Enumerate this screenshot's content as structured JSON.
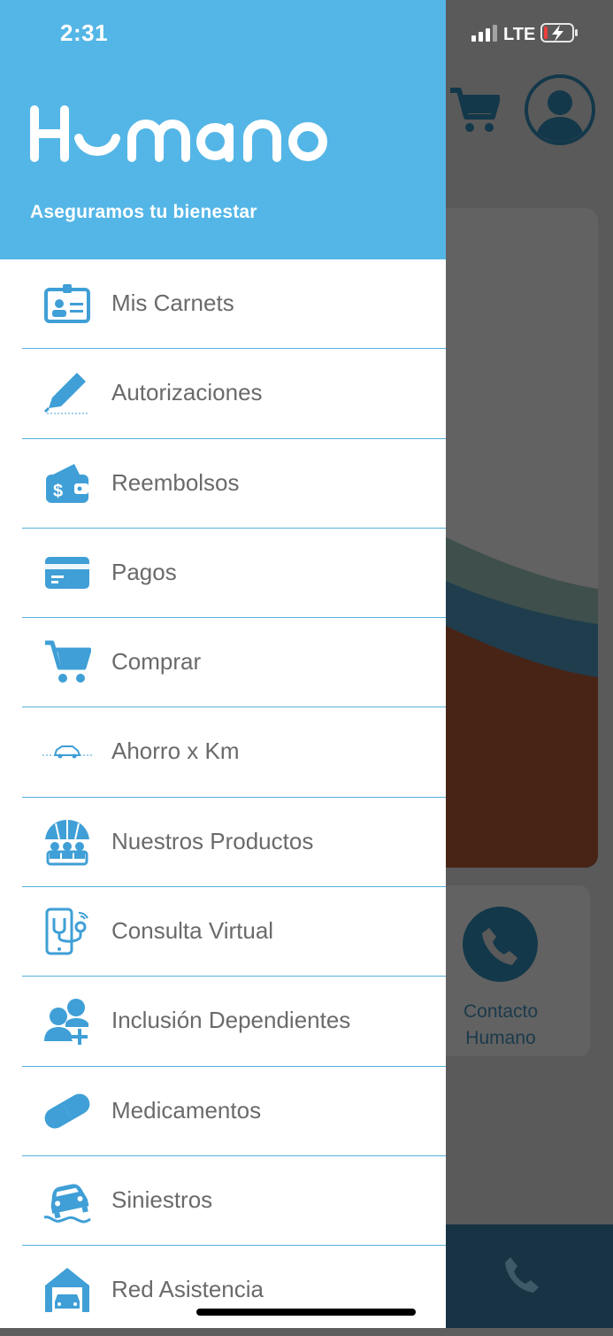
{
  "status_bar": {
    "time": "2:31",
    "network": "LTE"
  },
  "header": {
    "brand": "Humano",
    "tagline": "Aseguramos tu bienestar"
  },
  "menu": [
    {
      "label": "Mis Carnets",
      "icon": "id-card-icon"
    },
    {
      "label": "Autorizaciones",
      "icon": "pen-icon"
    },
    {
      "label": "Reembolsos",
      "icon": "wallet-icon"
    },
    {
      "label": "Pagos",
      "icon": "credit-card-icon"
    },
    {
      "label": "Comprar",
      "icon": "cart-icon"
    },
    {
      "label": "Ahorro x Km",
      "icon": "car-icon"
    },
    {
      "label": "Nuestros Productos",
      "icon": "umbrella-family-icon"
    },
    {
      "label": "Consulta Virtual",
      "icon": "phone-stethoscope-icon"
    },
    {
      "label": "Inclusión Dependientes",
      "icon": "add-user-icon"
    },
    {
      "label": "Medicamentos",
      "icon": "pill-icon"
    },
    {
      "label": "Siniestros",
      "icon": "car-accident-icon"
    },
    {
      "label": "Red Asistencia",
      "icon": "garage-icon"
    }
  ],
  "background": {
    "contact_label": "Contacto Humano"
  },
  "colors": {
    "primary": "#54b6e6",
    "overlay": "#5a5a5a",
    "dark_teal": "#13384a",
    "text": "#6a6a6a"
  }
}
